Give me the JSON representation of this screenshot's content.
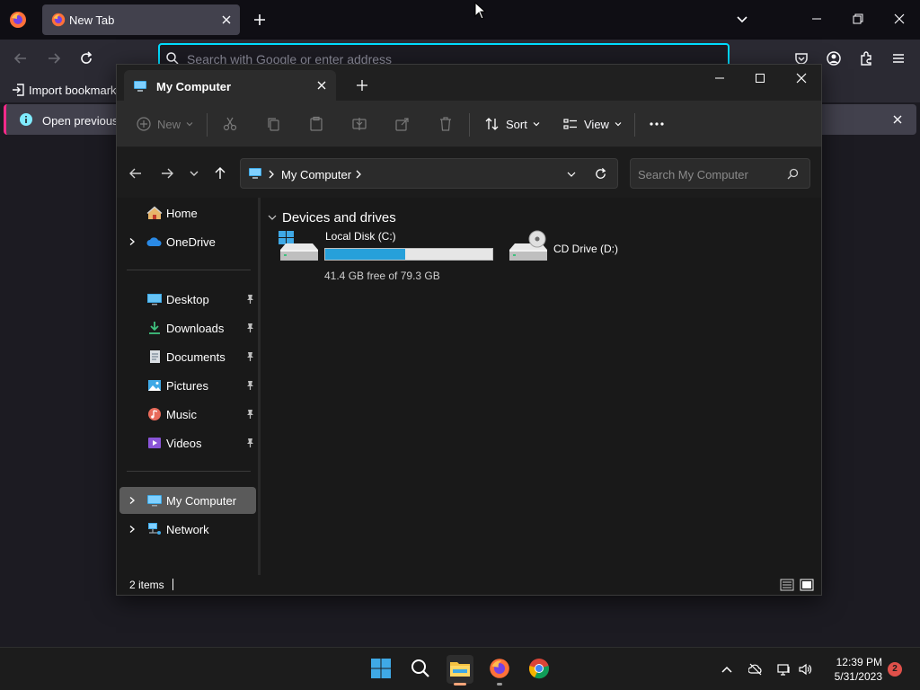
{
  "browser": {
    "tab_title": "New Tab",
    "url_placeholder": "Search with Google or enter address",
    "bookmark_import_label": "Import bookmarks",
    "notice_text": "Open previous t",
    "colors": {
      "accent": "#00ddff",
      "notice_stripe": "#ff2a8a"
    }
  },
  "explorer": {
    "tab_title": "My Computer",
    "commands": {
      "new_label": "New",
      "sort_label": "Sort",
      "view_label": "View"
    },
    "address": {
      "location": "My Computer"
    },
    "search_placeholder": "Search My Computer",
    "nav": {
      "home": "Home",
      "onedrive": "OneDrive",
      "quick_access": [
        {
          "label": "Desktop",
          "icon": "desktop-icon"
        },
        {
          "label": "Downloads",
          "icon": "downloads-icon"
        },
        {
          "label": "Documents",
          "icon": "documents-icon"
        },
        {
          "label": "Pictures",
          "icon": "pictures-icon"
        },
        {
          "label": "Music",
          "icon": "music-icon"
        },
        {
          "label": "Videos",
          "icon": "videos-icon"
        }
      ],
      "my_computer": "My Computer",
      "network": "Network"
    },
    "content": {
      "group_title": "Devices and drives",
      "drives": [
        {
          "name": "Local Disk (C:)",
          "free_text": "41.4 GB free of 79.3 GB",
          "used_fraction": 0.478,
          "icon": "local-disk-icon"
        },
        {
          "name": "CD Drive (D:)",
          "icon": "cd-drive-icon"
        }
      ]
    },
    "status": {
      "item_count": "2 items"
    },
    "colors": {
      "usage_bar": "#26a0da",
      "selected": "#5a5a5a"
    }
  },
  "taskbar": {
    "time": "12:39 PM",
    "date": "5/31/2023",
    "notification_count": "2"
  }
}
